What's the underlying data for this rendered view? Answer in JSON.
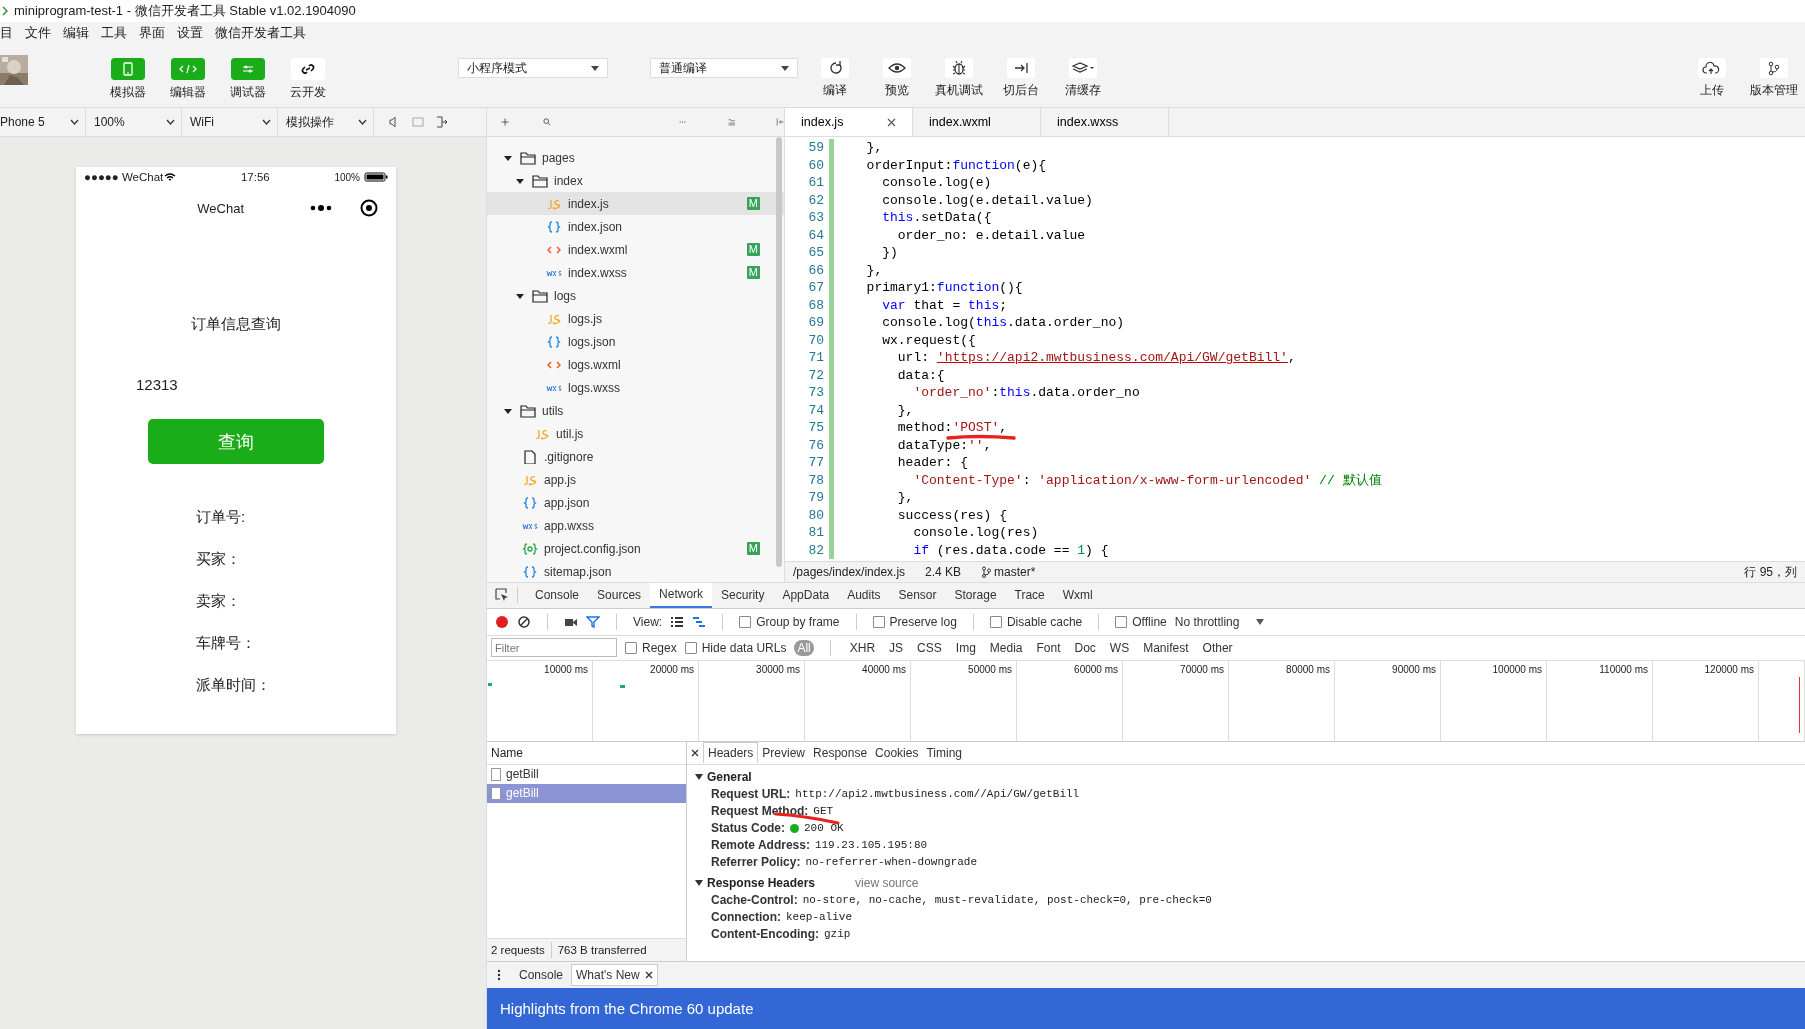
{
  "window": {
    "title": "miniprogram-test-1 - 微信开发者工具 Stable v1.02.1904090"
  },
  "menu": [
    "目",
    "文件",
    "编辑",
    "工具",
    "界面",
    "设置",
    "微信开发者工具"
  ],
  "toolbar": {
    "view_toggles": [
      {
        "label": "模拟器",
        "on": true
      },
      {
        "label": "编辑器",
        "on": true
      },
      {
        "label": "调试器",
        "on": true
      },
      {
        "label": "云开发",
        "on": false
      }
    ],
    "mode_select": "小程序模式",
    "compile_select": "普通编译",
    "actions": [
      "编译",
      "预览",
      "真机调试",
      "切后台",
      "清缓存"
    ],
    "right_actions": [
      "上传",
      "版本管理"
    ]
  },
  "simulator_bar": {
    "device": "Phone 5",
    "zoom": "100%",
    "network": "WiFi",
    "operation": "模拟操作"
  },
  "editor_tabs": [
    {
      "label": "index.js",
      "selected": true
    },
    {
      "label": "index.wxml",
      "selected": false
    },
    {
      "label": "index.wxss",
      "selected": false
    }
  ],
  "file_tree": [
    {
      "name": "pages",
      "kind": "folder",
      "expanded": true,
      "selected": false,
      "children": [
        {
          "name": "index",
          "kind": "folder",
          "expanded": true,
          "selected": false,
          "children": [
            {
              "name": "index.js",
              "kind": "js",
              "selected": true,
              "badge": "M"
            },
            {
              "name": "index.json",
              "kind": "json",
              "selected": false
            },
            {
              "name": "index.wxml",
              "kind": "wxml",
              "selected": false,
              "badge": "M"
            },
            {
              "name": "index.wxss",
              "kind": "wxss",
              "selected": false,
              "badge": "M"
            }
          ]
        },
        {
          "name": "logs",
          "kind": "folder",
          "expanded": true,
          "selected": false,
          "children": [
            {
              "name": "logs.js",
              "kind": "js",
              "selected": false
            },
            {
              "name": "logs.json",
              "kind": "json",
              "selected": false
            },
            {
              "name": "logs.wxml",
              "kind": "wxml",
              "selected": false
            },
            {
              "name": "logs.wxss",
              "kind": "wxss",
              "selected": false
            }
          ]
        }
      ]
    },
    {
      "name": "utils",
      "kind": "folder",
      "expanded": true,
      "selected": false,
      "children": [
        {
          "name": "util.js",
          "kind": "js",
          "selected": false
        }
      ]
    },
    {
      "name": ".gitignore",
      "kind": "file",
      "selected": false
    },
    {
      "name": "app.js",
      "kind": "js",
      "selected": false
    },
    {
      "name": "app.json",
      "kind": "json",
      "selected": false
    },
    {
      "name": "app.wxss",
      "kind": "wxss",
      "selected": false
    },
    {
      "name": "project.config.json",
      "kind": "config",
      "selected": false,
      "badge": "M"
    },
    {
      "name": "sitemap.json",
      "kind": "json",
      "selected": false
    }
  ],
  "code": [
    {
      "number": "59",
      "tokens": [
        {
          "kind": "plain",
          "text": "  },"
        }
      ]
    },
    {
      "number": "60",
      "tokens": [
        {
          "kind": "plain",
          "text": "  orderInput:"
        },
        {
          "kind": "keyword",
          "text": "function"
        },
        {
          "kind": "plain",
          "text": "(e){"
        }
      ]
    },
    {
      "number": "61",
      "tokens": [
        {
          "kind": "plain",
          "text": "    console.log(e)"
        }
      ]
    },
    {
      "number": "62",
      "tokens": [
        {
          "kind": "plain",
          "text": "    console.log(e.detail.value)"
        }
      ]
    },
    {
      "number": "63",
      "tokens": [
        {
          "kind": "keyword",
          "text": "    this"
        },
        {
          "kind": "plain",
          "text": ".setData({"
        }
      ]
    },
    {
      "number": "64",
      "tokens": [
        {
          "kind": "plain",
          "text": "      order_no: e.detail.value"
        }
      ]
    },
    {
      "number": "65",
      "tokens": [
        {
          "kind": "plain",
          "text": "    })"
        }
      ]
    },
    {
      "number": "66",
      "tokens": [
        {
          "kind": "plain",
          "text": "  },"
        }
      ]
    },
    {
      "number": "67",
      "tokens": [
        {
          "kind": "plain",
          "text": "  primary1:"
        },
        {
          "kind": "keyword",
          "text": "function"
        },
        {
          "kind": "plain",
          "text": "(){"
        }
      ]
    },
    {
      "number": "68",
      "tokens": [
        {
          "kind": "keyword",
          "text": "    var"
        },
        {
          "kind": "plain",
          "text": " that = "
        },
        {
          "kind": "keyword",
          "text": "this"
        },
        {
          "kind": "plain",
          "text": ";"
        }
      ]
    },
    {
      "number": "69",
      "tokens": [
        {
          "kind": "plain",
          "text": "    console.log("
        },
        {
          "kind": "keyword",
          "text": "this"
        },
        {
          "kind": "plain",
          "text": ".data.order_no)"
        }
      ]
    },
    {
      "number": "70",
      "tokens": [
        {
          "kind": "plain",
          "text": "    wx.request({"
        }
      ]
    },
    {
      "number": "71",
      "tokens": [
        {
          "kind": "plain",
          "text": "      url: "
        },
        {
          "kind": "url",
          "text": "'https://api2.mwtbusiness.com/Api/GW/getBill'"
        },
        {
          "kind": "plain",
          "text": ","
        }
      ]
    },
    {
      "number": "72",
      "tokens": [
        {
          "kind": "plain",
          "text": "      data:{"
        }
      ]
    },
    {
      "number": "73",
      "tokens": [
        {
          "kind": "string",
          "text": "        'order_no'"
        },
        {
          "kind": "plain",
          "text": ":"
        },
        {
          "kind": "keyword",
          "text": "this"
        },
        {
          "kind": "plain",
          "text": ".data.order_no"
        }
      ]
    },
    {
      "number": "74",
      "tokens": [
        {
          "kind": "plain",
          "text": "      },"
        }
      ]
    },
    {
      "number": "75",
      "tokens": [
        {
          "kind": "plain",
          "text": "      method:"
        },
        {
          "kind": "string",
          "text": "'POST'",
          "marked": true
        },
        {
          "kind": "plain",
          "text": ","
        }
      ]
    },
    {
      "number": "76",
      "tokens": [
        {
          "kind": "plain",
          "text": "      dataType:"
        },
        {
          "kind": "string",
          "text": "''"
        },
        {
          "kind": "plain",
          "text": ","
        }
      ]
    },
    {
      "number": "77",
      "tokens": [
        {
          "kind": "plain",
          "text": "      header: {"
        }
      ]
    },
    {
      "number": "78",
      "tokens": [
        {
          "kind": "string",
          "text": "        'Content-Type'"
        },
        {
          "kind": "plain",
          "text": ": "
        },
        {
          "kind": "string",
          "text": "'application/x-www-form-urlencoded'"
        },
        {
          "kind": "comment",
          "text": " // 默认值"
        }
      ]
    },
    {
      "number": "79",
      "tokens": [
        {
          "kind": "plain",
          "text": "      },"
        }
      ]
    },
    {
      "number": "80",
      "tokens": [
        {
          "kind": "plain",
          "text": "      success(res) {"
        }
      ]
    },
    {
      "number": "81",
      "tokens": [
        {
          "kind": "plain",
          "text": "        console.log(res)"
        }
      ]
    },
    {
      "number": "82",
      "tokens": [
        {
          "kind": "keyword",
          "text": "        if"
        },
        {
          "kind": "plain",
          "text": " (res.data.code == "
        },
        {
          "kind": "number",
          "text": "1"
        },
        {
          "kind": "plain",
          "text": ") {"
        }
      ]
    }
  ],
  "editor_status": {
    "path": "/pages/index/index.js",
    "size": "2.4 KB",
    "branch": "master*",
    "position": "行 95，列"
  },
  "phone": {
    "carrier": "●●●●● WeChat",
    "time": "17:56",
    "battery": "100%",
    "nav_title": "WeChat",
    "heading": "订单信息查询",
    "order_input": {
      "value": "12313"
    },
    "query_button": "查询",
    "fields": [
      "订单号:",
      "买家：",
      "卖家：",
      "车牌号：",
      "派单时间："
    ]
  },
  "devtools": {
    "tabs": [
      {
        "label": "Console",
        "selected": false
      },
      {
        "label": "Sources",
        "selected": false
      },
      {
        "label": "Network",
        "selected": true
      },
      {
        "label": "Security",
        "selected": false
      },
      {
        "label": "AppData",
        "selected": false
      },
      {
        "label": "Audits",
        "selected": false
      },
      {
        "label": "Sensor",
        "selected": false
      },
      {
        "label": "Storage",
        "selected": false
      },
      {
        "label": "Trace",
        "selected": false
      },
      {
        "label": "Wxml",
        "selected": false
      }
    ],
    "view_label": "View:",
    "options": [
      {
        "label": "Group by frame",
        "checked": false
      },
      {
        "label": "Preserve log",
        "checked": false
      },
      {
        "label": "Disable cache",
        "checked": false
      },
      {
        "label": "Offline",
        "checked": false
      }
    ],
    "throttling": "No throttling",
    "filter": {
      "placeholder": "Filter"
    },
    "filter_options": [
      {
        "label": "Regex",
        "checked": false
      },
      {
        "label": "Hide data URLs",
        "checked": false
      }
    ],
    "types": [
      {
        "label": "All",
        "selected": true
      },
      {
        "label": "XHR",
        "selected": false
      },
      {
        "label": "JS",
        "selected": false
      },
      {
        "label": "CSS",
        "selected": false
      },
      {
        "label": "Img",
        "selected": false
      },
      {
        "label": "Media",
        "selected": false
      },
      {
        "label": "Font",
        "selected": false
      },
      {
        "label": "Doc",
        "selected": false
      },
      {
        "label": "WS",
        "selected": false
      },
      {
        "label": "Manifest",
        "selected": false
      },
      {
        "label": "Other",
        "selected": false
      }
    ],
    "timeline_ticks": [
      "10000 ms",
      "20000 ms",
      "30000 ms",
      "40000 ms",
      "50000 ms",
      "60000 ms",
      "70000 ms",
      "80000 ms",
      "90000 ms",
      "100000 ms",
      "110000 ms",
      "120000 ms"
    ],
    "requests_header": "Name",
    "requests": [
      {
        "name": "getBill",
        "selected": false
      },
      {
        "name": "getBill",
        "selected": true
      }
    ],
    "requests_summary": [
      "2 requests",
      "763 B transferred"
    ],
    "detail_tabs": [
      {
        "label": "Headers",
        "selected": true
      },
      {
        "label": "Preview",
        "selected": false
      },
      {
        "label": "Response",
        "selected": false
      },
      {
        "label": "Cookies",
        "selected": false
      },
      {
        "label": "Timing",
        "selected": false
      }
    ],
    "sections": [
      {
        "title": "General",
        "expanded": true,
        "rows": [
          {
            "name": "Request URL:",
            "value": "http://api2.mwtbusiness.com//Api/GW/getBill",
            "kind": "plain"
          },
          {
            "name": "Request Method:",
            "value": "GET",
            "kind": "marked"
          },
          {
            "name": "Status Code:",
            "value": "200 OK",
            "kind": "status"
          },
          {
            "name": "Remote Address:",
            "value": "119.23.105.195:80",
            "kind": "plain"
          },
          {
            "name": "Referrer Policy:",
            "value": "no-referrer-when-downgrade",
            "kind": "plain"
          }
        ]
      },
      {
        "title": "Response Headers",
        "link": "view source",
        "expanded": true,
        "rows": [
          {
            "name": "Cache-Control:",
            "value": "no-store, no-cache, must-revalidate, post-check=0, pre-check=0",
            "kind": "plain"
          },
          {
            "name": "Connection:",
            "value": "keep-alive",
            "kind": "plain"
          },
          {
            "name": "Content-Encoding:",
            "value": "gzip",
            "kind": "plain"
          }
        ]
      }
    ],
    "drawer_tabs": [
      {
        "label": "Console",
        "selected": false
      },
      {
        "label": "What's New",
        "selected": true
      }
    ],
    "banner": "Highlights from the Chrome 60 update"
  }
}
